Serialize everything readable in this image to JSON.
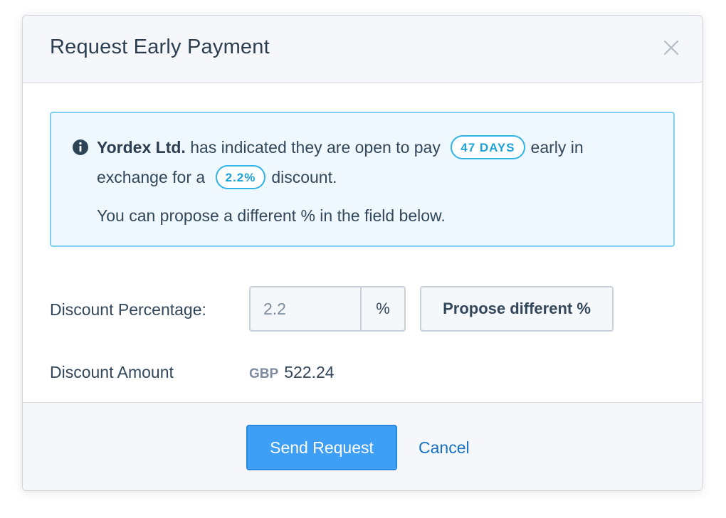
{
  "modal": {
    "title": "Request Early Payment"
  },
  "info": {
    "company": "Yordex Ltd.",
    "text_before_days": "has indicated they are open to pay",
    "days_badge": "47 DAYS",
    "text_after_days": "early in",
    "text_before_pct": "exchange for a",
    "pct_badge": "2.2%",
    "text_after_pct": "discount.",
    "hint": "You can propose a different % in the field below."
  },
  "form": {
    "discount_percentage_label": "Discount Percentage:",
    "discount_percentage_value": "2.2",
    "percent_addon": "%",
    "propose_button": "Propose different %",
    "discount_amount_label": "Discount Amount",
    "currency": "GBP",
    "amount": "522.24"
  },
  "footer": {
    "send_button": "Send Request",
    "cancel_link": "Cancel"
  },
  "colors": {
    "primary": "#3d9ff5",
    "info_border": "#7fd1f2",
    "info_bg": "#eef8fe",
    "badge": "#1ba2d8",
    "link": "#1772c4"
  },
  "icons": [
    "close-icon",
    "info-icon"
  ]
}
